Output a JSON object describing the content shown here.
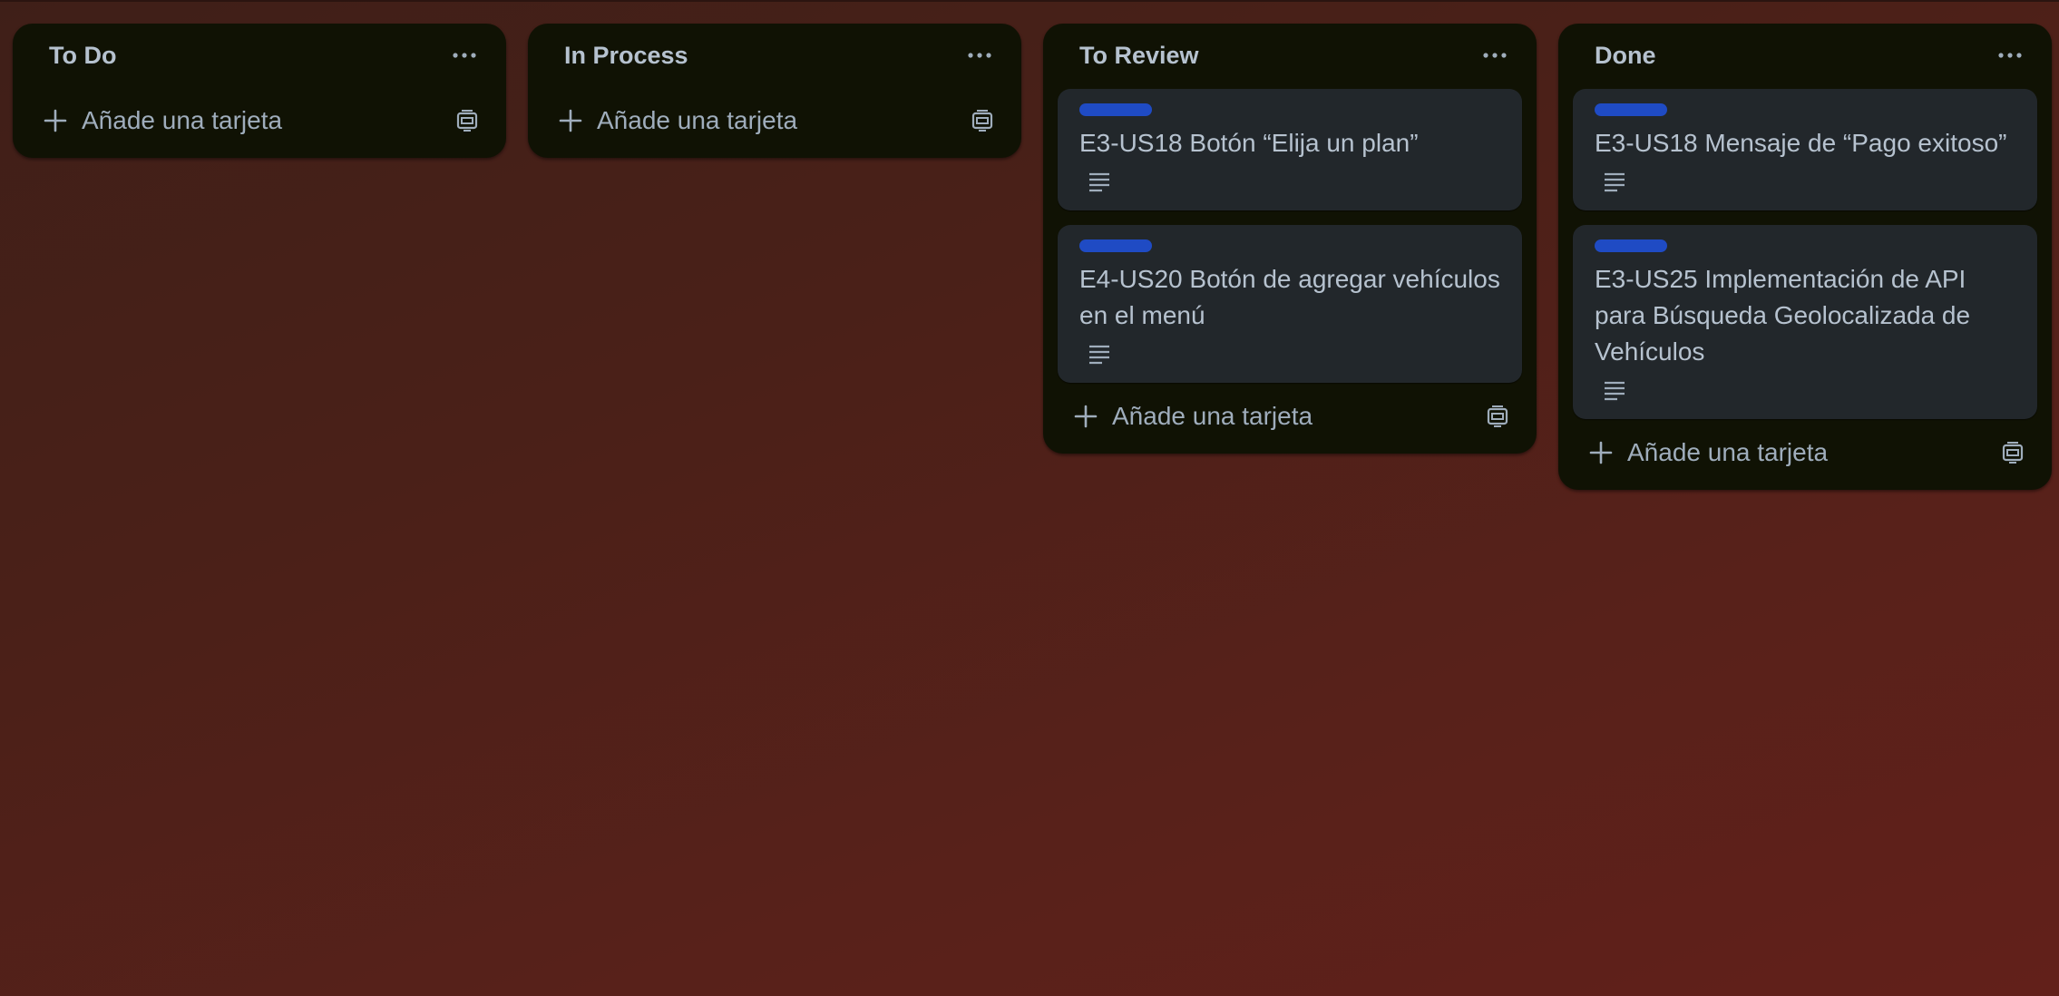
{
  "board": {
    "lists": [
      {
        "title": "To Do",
        "add_label": "Añade una tarjeta",
        "cards": []
      },
      {
        "title": "In Process",
        "add_label": "Añade una tarjeta",
        "cards": []
      },
      {
        "title": "To Review",
        "add_label": "Añade una tarjeta",
        "cards": [
          {
            "title": "E3-US18 Botón “Elija un plan”"
          },
          {
            "title": "E4-US20 Botón de agregar vehículos en el menú"
          }
        ]
      },
      {
        "title": "Done",
        "add_label": "Añade una tarjeta",
        "cards": [
          {
            "title": "E3-US18 Mensaje de “Pago exitoso”"
          },
          {
            "title": "E3-US25 Implementación de API para Búsqueda Geolocalizada de Vehículos"
          }
        ]
      }
    ]
  },
  "colors": {
    "list_bg": "#101204",
    "card_bg": "#22272b",
    "label_blue": "#1f4bc4",
    "text": "#b6c2cf",
    "background_dark": "#3f1f18",
    "background_red": "#62201a"
  },
  "icons": {
    "list_menu": "more-horizontal-icon",
    "add": "plus-icon",
    "template": "card-template-icon",
    "description": "description-icon"
  }
}
